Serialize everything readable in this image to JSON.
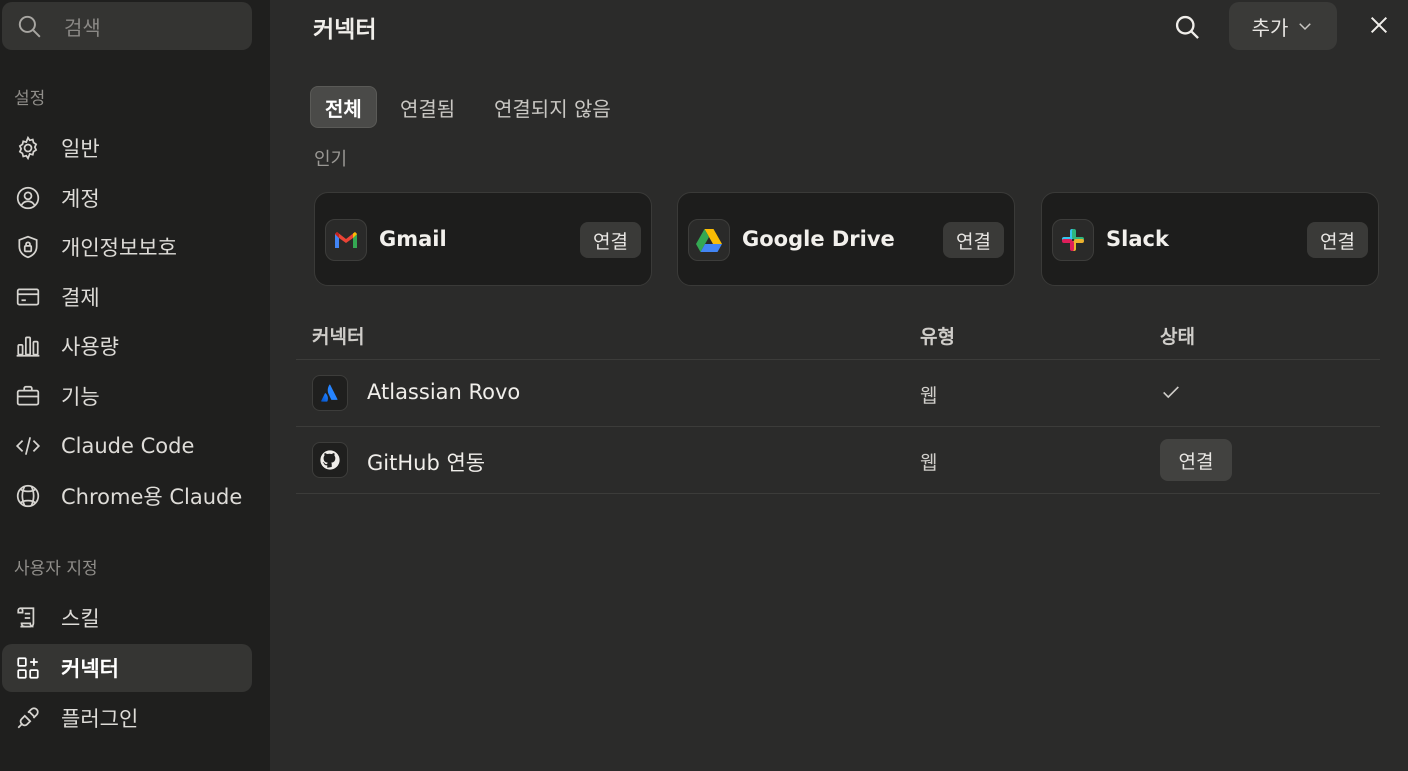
{
  "sidebar": {
    "search_placeholder": "검색",
    "settings_label": "설정",
    "settings_items": [
      {
        "label": "일반",
        "icon": "gear-icon"
      },
      {
        "label": "계정",
        "icon": "user-circle-icon"
      },
      {
        "label": "개인정보보호",
        "icon": "shield-lock-icon"
      },
      {
        "label": "결제",
        "icon": "credit-card-icon"
      },
      {
        "label": "사용량",
        "icon": "bar-chart-icon"
      },
      {
        "label": "기능",
        "icon": "briefcase-icon"
      },
      {
        "label": "Claude Code",
        "icon": "code-icon"
      },
      {
        "label": "Chrome용 Claude",
        "icon": "globe-icon"
      }
    ],
    "custom_label": "사용자 지정",
    "custom_items": [
      {
        "label": "스킬",
        "icon": "scroll-icon"
      },
      {
        "label": "커넥터",
        "icon": "grid-plus-icon",
        "active": true
      },
      {
        "label": "플러그인",
        "icon": "plug-icon"
      }
    ]
  },
  "header": {
    "title": "커넥터",
    "add_label": "추가"
  },
  "tabs": [
    {
      "label": "전체",
      "active": true
    },
    {
      "label": "연결됨"
    },
    {
      "label": "연결되지 않음"
    }
  ],
  "popular": {
    "label": "인기",
    "cards": [
      {
        "name": "Gmail",
        "connect_label": "연결",
        "icon": "gmail-icon"
      },
      {
        "name": "Google Drive",
        "connect_label": "연결",
        "icon": "google-drive-icon"
      },
      {
        "name": "Slack",
        "connect_label": "연결",
        "icon": "slack-icon"
      }
    ]
  },
  "table": {
    "headers": {
      "connector": "커넥터",
      "type": "유형",
      "status": "상태"
    },
    "rows": [
      {
        "name": "Atlassian Rovo",
        "type": "웹",
        "status": "connected",
        "icon": "atlassian-icon"
      },
      {
        "name": "GitHub 연동",
        "type": "웹",
        "status_label": "연결",
        "icon": "github-icon"
      }
    ]
  },
  "colors": {
    "sidebar_bg": "#1f1f1e",
    "main_bg": "#2b2b2a",
    "card_bg": "#1d1d1c",
    "button_bg": "#3a3a38"
  }
}
